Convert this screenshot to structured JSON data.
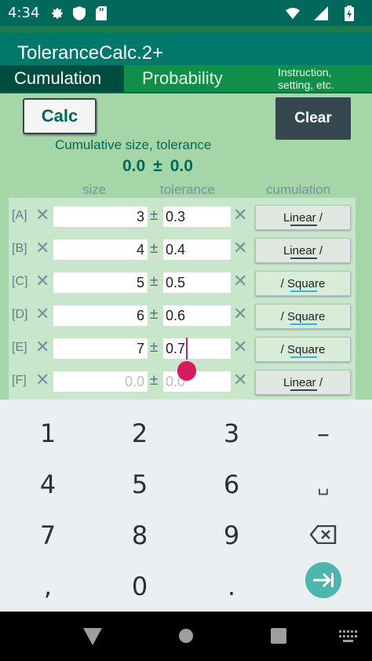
{
  "status": {
    "time": "4:34"
  },
  "app": {
    "title": "ToleranceCalc.2+"
  },
  "tabs": [
    {
      "label": "Cumulation"
    },
    {
      "label": "Probability"
    },
    {
      "label_line1": "Instruction,",
      "label_line2": "setting, etc."
    }
  ],
  "buttons": {
    "calc": "Calc",
    "clear": "Clear"
  },
  "result": {
    "label": "Cumulative size, tolerance",
    "size": "0.0",
    "pm": "±",
    "tolerance": "0.0"
  },
  "columns": {
    "size": "size",
    "tolerance": "tolerance",
    "cumulation": "cumulation"
  },
  "rows": [
    {
      "label": "[A]",
      "size": "3",
      "tolerance": "0.3",
      "mode": "Linear /"
    },
    {
      "label": "[B]",
      "size": "4",
      "tolerance": "0.4",
      "mode": "Linear /"
    },
    {
      "label": "[C]",
      "size": "5",
      "tolerance": "0.5",
      "mode": "/ Square"
    },
    {
      "label": "[D]",
      "size": "6",
      "tolerance": "0.6",
      "mode": "/ Square"
    },
    {
      "label": "[E]",
      "size": "7",
      "tolerance": "0.7",
      "mode": "/ Square"
    },
    {
      "label": "[F]",
      "size_placeholder": "0.0",
      "tolerance_placeholder": "0.0",
      "mode": "Linear /"
    }
  ],
  "keyboard": {
    "keys": [
      "1",
      "2",
      "3",
      "–",
      "4",
      "5",
      "6",
      "␣",
      "7",
      "8",
      "9",
      "⌫",
      ",",
      "0",
      "."
    ]
  },
  "colors": {
    "accent": "#00796b",
    "tab_active": "#004d40",
    "cursor": "#d81b60",
    "enter": "#4db6ac"
  }
}
